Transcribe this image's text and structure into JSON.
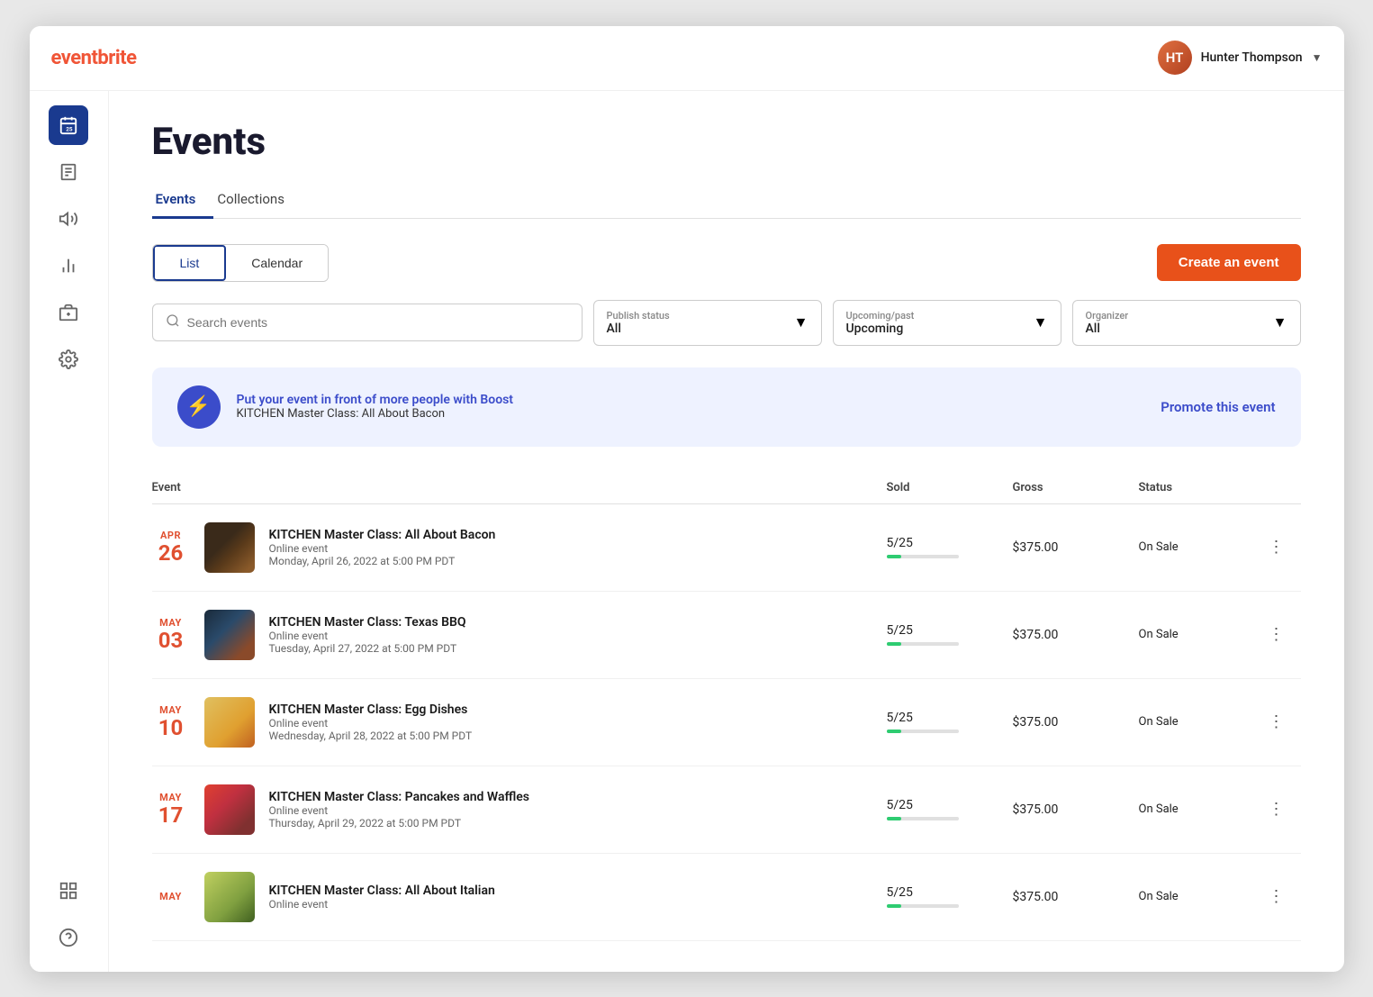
{
  "app": {
    "logo": "eventbrite"
  },
  "header": {
    "user_name": "Hunter Thompson",
    "user_initials": "HT"
  },
  "sidebar": {
    "icons": [
      {
        "name": "calendar-icon",
        "label": "Calendar",
        "active": true
      },
      {
        "name": "list-icon",
        "label": "Orders"
      },
      {
        "name": "megaphone-icon",
        "label": "Promotions"
      },
      {
        "name": "chart-icon",
        "label": "Analytics"
      },
      {
        "name": "bank-icon",
        "label": "Finance"
      },
      {
        "name": "settings-icon",
        "label": "Settings"
      },
      {
        "name": "grid-icon",
        "label": "Apps"
      },
      {
        "name": "help-icon",
        "label": "Help"
      }
    ]
  },
  "page": {
    "title": "Events",
    "tabs": [
      {
        "label": "Events",
        "active": true
      },
      {
        "label": "Collections",
        "active": false
      }
    ]
  },
  "toolbar": {
    "view_list_label": "List",
    "view_calendar_label": "Calendar",
    "create_label": "Create an event"
  },
  "filters": {
    "search_placeholder": "Search events",
    "publish_status_label": "Publish status",
    "publish_status_value": "All",
    "upcoming_label": "Upcoming/past",
    "upcoming_value": "Upcoming",
    "organizer_label": "Organizer",
    "organizer_value": "All"
  },
  "boost_banner": {
    "main_text": "Put your event in front of more people with Boost",
    "sub_text": "KITCHEN Master Class: All About Bacon",
    "cta": "Promote this event"
  },
  "table": {
    "headers": [
      "Event",
      "Sold",
      "Gross",
      "Status",
      ""
    ],
    "events": [
      {
        "month": "APR",
        "day": "26",
        "thumb_class": "event-thumb-bacon",
        "name": "KITCHEN Master Class: All About Bacon",
        "type": "Online event",
        "datetime": "Monday, April 26, 2022 at 5:00 PM PDT",
        "sold": "5/25",
        "sold_pct": 20,
        "gross": "$375.00",
        "status": "On Sale"
      },
      {
        "month": "MAY",
        "day": "03",
        "thumb_class": "event-thumb-bbq",
        "name": "KITCHEN Master Class: Texas BBQ",
        "type": "Online event",
        "datetime": "Tuesday, April 27, 2022 at 5:00 PM PDT",
        "sold": "5/25",
        "sold_pct": 20,
        "gross": "$375.00",
        "status": "On Sale"
      },
      {
        "month": "MAY",
        "day": "10",
        "thumb_class": "event-thumb-egg",
        "name": "KITCHEN Master Class: Egg Dishes",
        "type": "Online event",
        "datetime": "Wednesday, April 28, 2022 at 5:00 PM PDT",
        "sold": "5/25",
        "sold_pct": 20,
        "gross": "$375.00",
        "status": "On Sale"
      },
      {
        "month": "MAY",
        "day": "17",
        "thumb_class": "event-thumb-pancake",
        "name": "KITCHEN Master Class: Pancakes and Waffles",
        "type": "Online event",
        "datetime": "Thursday, April 29, 2022 at 5:00 PM PDT",
        "sold": "5/25",
        "sold_pct": 20,
        "gross": "$375.00",
        "status": "On Sale"
      },
      {
        "month": "MAY",
        "day": "",
        "thumb_class": "event-thumb-italian",
        "name": "KITCHEN Master Class: All About Italian",
        "type": "Online event",
        "datetime": "",
        "sold": "5/25",
        "sold_pct": 20,
        "gross": "$375.00",
        "status": "On Sale"
      }
    ]
  }
}
